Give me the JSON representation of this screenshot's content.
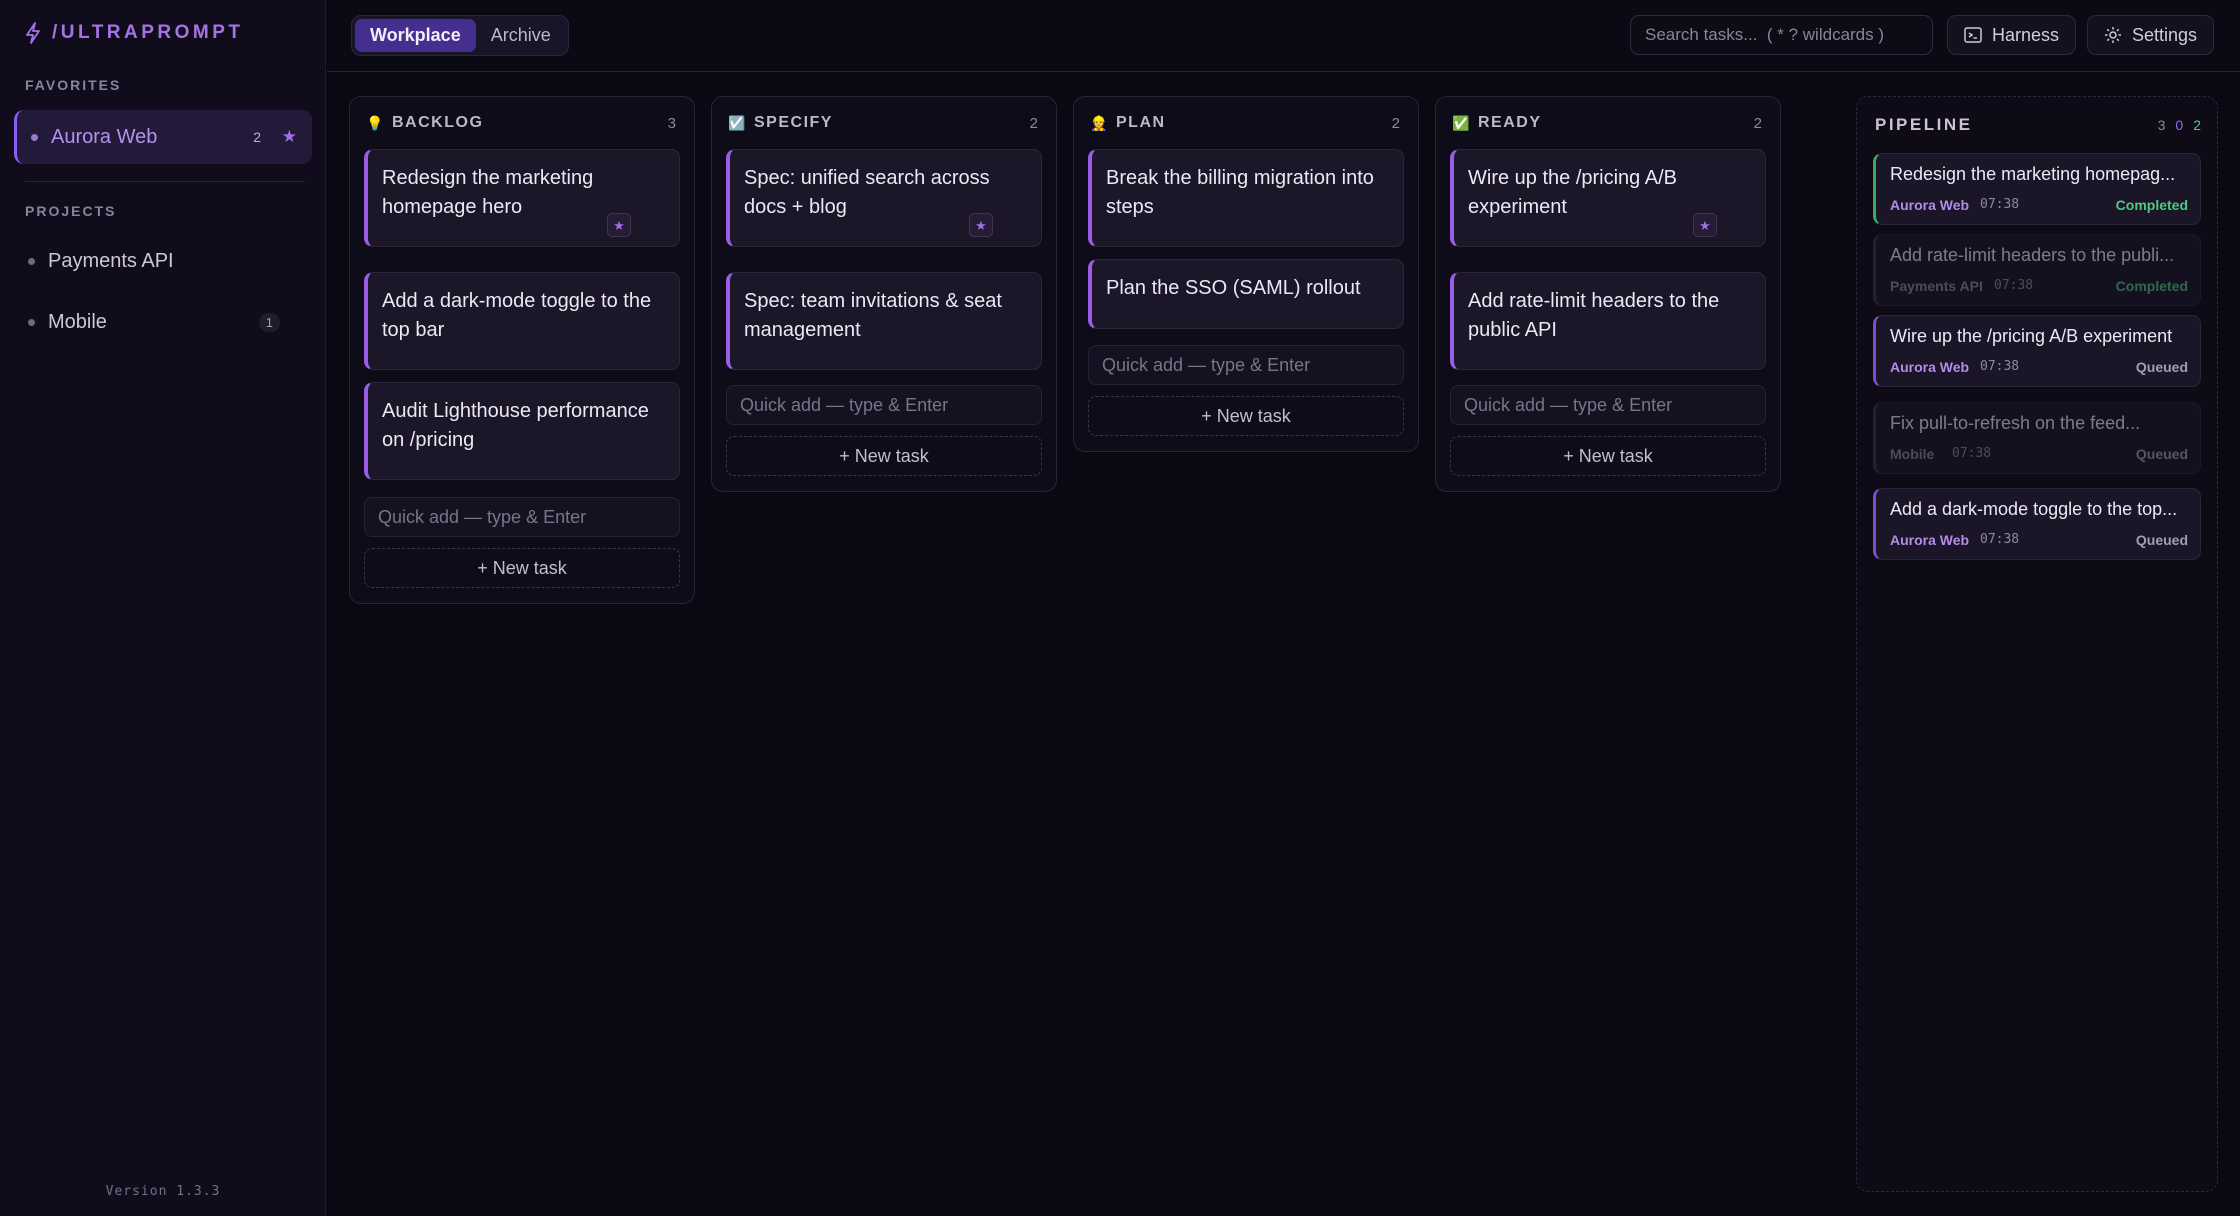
{
  "brand": {
    "name": "/ULTRAPROMPT"
  },
  "sidebar": {
    "favorites_label": "FAVORITES",
    "favorites": [
      {
        "label": "Aurora Web",
        "count": "2",
        "starred": true
      }
    ],
    "projects_label": "PROJECTS",
    "projects": [
      {
        "label": "Payments API",
        "count": ""
      },
      {
        "label": "Mobile",
        "count": "1"
      }
    ],
    "version": "Version 1.3.3"
  },
  "topbar": {
    "tabs": [
      {
        "label": "Workplace",
        "active": true
      },
      {
        "label": "Archive",
        "active": false
      }
    ],
    "search_placeholder": "Search tasks...  ( * ? wildcards )",
    "harness_label": "Harness",
    "settings_label": "Settings"
  },
  "columns": [
    {
      "title": "BACKLOG",
      "icon": "lightbulb-icon",
      "emoji": "💡",
      "count": "3",
      "cards": [
        {
          "title": "Redesign the marketing homepage hero",
          "pinned": true
        },
        {
          "title": "Add a dark-mode toggle to the top bar",
          "pinned": false
        },
        {
          "title": "Audit Lighthouse performance on /pricing",
          "pinned": false
        }
      ],
      "quick_add_placeholder": "Quick add — type & Enter",
      "new_task_label": "+ New task"
    },
    {
      "title": "SPECIFY",
      "icon": "checkbox-icon",
      "emoji": "☑️",
      "count": "2",
      "cards": [
        {
          "title": "Spec: unified search across docs + blog",
          "pinned": true
        },
        {
          "title": "Spec: team invitations & seat management",
          "pinned": false
        }
      ],
      "quick_add_placeholder": "Quick add — type & Enter",
      "new_task_label": "+ New task"
    },
    {
      "title": "PLAN",
      "icon": "person-icon",
      "emoji": "👷",
      "count": "2",
      "cards": [
        {
          "title": "Break the billing migration into steps",
          "pinned": false
        },
        {
          "title": "Plan the SSO (SAML) rollout",
          "pinned": false
        }
      ],
      "quick_add_placeholder": "Quick add — type & Enter",
      "new_task_label": "+ New task"
    },
    {
      "title": "READY",
      "icon": "check-icon",
      "emoji": "✅",
      "count": "2",
      "cards": [
        {
          "title": "Wire up the /pricing A/B experiment",
          "pinned": true
        },
        {
          "title": "Add rate-limit headers to the public API",
          "pinned": false
        }
      ],
      "quick_add_placeholder": "Quick add — type & Enter",
      "new_task_label": "+ New task"
    }
  ],
  "pipeline": {
    "title": "PIPELINE",
    "counts": [
      {
        "value": "3",
        "color": "#8d879b"
      },
      {
        "value": "0",
        "color": "#8b6cf0"
      },
      {
        "value": "2",
        "color": "#4fc785"
      }
    ],
    "items": [
      {
        "title": "Redesign the marketing homepag...",
        "project": "Aurora Web",
        "time": "07:38",
        "status": "Completed",
        "state": "done",
        "dim": false
      },
      {
        "title": "Add rate-limit headers to the publi...",
        "project": "Payments API",
        "time": "07:38",
        "status": "Completed",
        "state": "done",
        "dim": true
      },
      {
        "title": "Wire up the /pricing A/B experiment",
        "project": "Aurora Web",
        "time": "07:38",
        "status": "Queued",
        "state": "queued",
        "dim": false
      },
      {
        "title": "Fix pull-to-refresh on the feed...",
        "project": "Mobile",
        "time": "07:38",
        "status": "Queued",
        "state": "queued",
        "dim": true
      },
      {
        "title": "Add a dark-mode toggle to the top...",
        "project": "Aurora Web",
        "time": "07:38",
        "status": "Queued",
        "state": "queued",
        "dim": false
      }
    ]
  },
  "colors": {
    "accent": "#9b5de5",
    "background": "#0a0812",
    "completed": "#4fc785"
  }
}
